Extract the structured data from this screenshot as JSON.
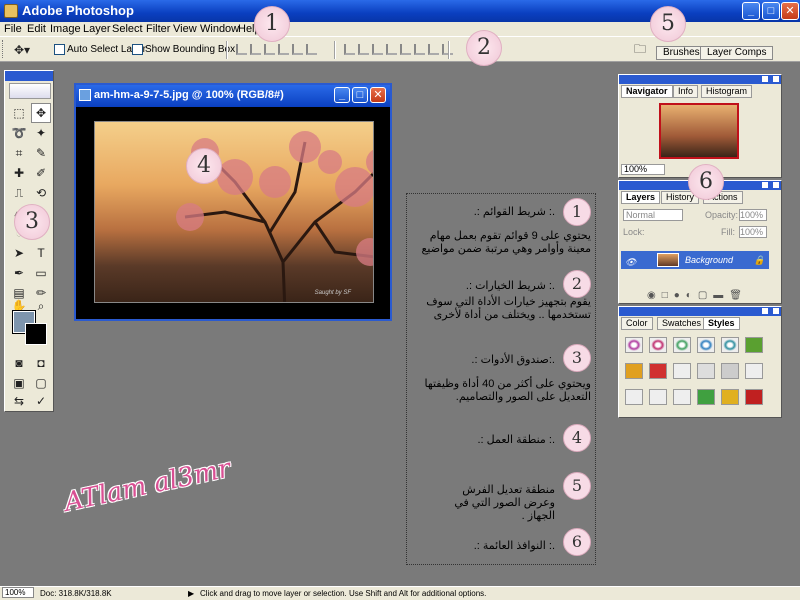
{
  "window": {
    "title": "Adobe Photoshop"
  },
  "menu": [
    "File",
    "Edit",
    "Image",
    "Layer",
    "Select",
    "Filter",
    "View",
    "Window",
    "Help"
  ],
  "options": {
    "auto_select": "Auto Select Layer",
    "show_bounding": "Show Bounding Box"
  },
  "palette_well": {
    "tabs": [
      "Brushes",
      "Layer Comps"
    ]
  },
  "document": {
    "title": "am-hm-a-9-7-5.jpg @ 100% (RGB/8#)",
    "signature": "Saught by SF"
  },
  "navigator": {
    "tabs": [
      "Navigator",
      "Info",
      "Histogram"
    ],
    "zoom": "100%"
  },
  "layers": {
    "tabs": [
      "Layers",
      "History",
      "Actions"
    ],
    "blend": "Normal",
    "opacity_label": "Opacity:",
    "opacity": "100%",
    "lock_label": "Lock:",
    "fill_label": "Fill:",
    "fill": "100%",
    "layer_name": "Background"
  },
  "styles_panel": {
    "tabs": [
      "Color",
      "Swatches",
      "Styles"
    ]
  },
  "annotations": {
    "items": [
      {
        "num": "1",
        "head": ".: شريط القوائم :.",
        "body": "يحتوي على 9 قوائم تقوم بعمل مهام معينة وأوامر وهي مرتبة ضمن مواضيع"
      },
      {
        "num": "2",
        "head": ".: شريط الخيارات :.",
        "body": "يقوم بتجهيز خيارات الأداة التي سوف تستخدمها .. ويختلف من أداة لأخرى"
      },
      {
        "num": "3",
        "head": ".:صندوق الأدوات :.",
        "body": "ويحتوي على أكثر من 40 أداة وظيفتها التعديل على الصور والتصاميم."
      },
      {
        "num": "4",
        "head": ".: منطقة العمل :.",
        "body": ""
      },
      {
        "num": "5",
        "head": "منطقة تعديل الفرش وعرض الصور التي في الجهاز .",
        "body": ""
      },
      {
        "num": "6",
        "head": ".: النوافذ العائمة :.",
        "body": ""
      }
    ],
    "markers": [
      "1",
      "2",
      "3",
      "4",
      "5",
      "6"
    ]
  },
  "watermark": "ATlam al3mr",
  "status": {
    "zoom": "100%",
    "doc": "Doc: 318.8K/318.8K",
    "hint": "Click and drag to move layer or selection.  Use Shift and Alt for additional options."
  },
  "colors": {
    "titlebar": "#0a3fc0",
    "chrome": "#ece9d8",
    "workspace": "#7a7a7a",
    "accent_pink": "#d94f93"
  }
}
